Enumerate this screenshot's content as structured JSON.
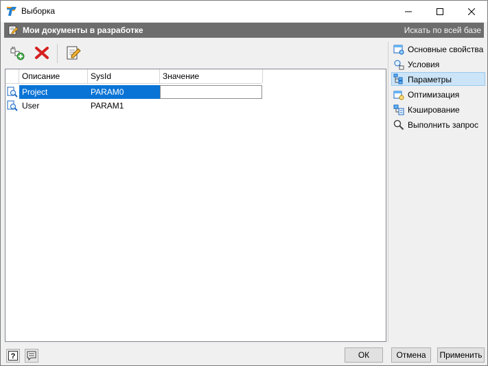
{
  "window": {
    "title": "Выборка"
  },
  "header": {
    "title": "Мои документы в разработке",
    "search_link": "Искать по всей базе"
  },
  "toolbar": {
    "items": [
      "add-parameter-icon",
      "delete-icon",
      "edit-icon"
    ]
  },
  "grid": {
    "columns": [
      "Описание",
      "SysId",
      "Значение"
    ],
    "rows": [
      {
        "desc": "Project",
        "sysid": "PARAM0",
        "value": ""
      },
      {
        "desc": "User",
        "sysid": "PARAM1",
        "value": ""
      }
    ]
  },
  "side": {
    "items": [
      {
        "label": "Основные свойства"
      },
      {
        "label": "Условия"
      },
      {
        "label": "Параметры"
      },
      {
        "label": "Оптимизация"
      },
      {
        "label": "Кэширование"
      },
      {
        "label": "Выполнить запрос"
      }
    ]
  },
  "footer": {
    "ok": "ОК",
    "cancel": "Отмена",
    "apply": "Применить"
  },
  "colors": {
    "header_bg": "#6d6d6d",
    "selection": "#0a74d6",
    "active_side": "#cce4f7"
  }
}
